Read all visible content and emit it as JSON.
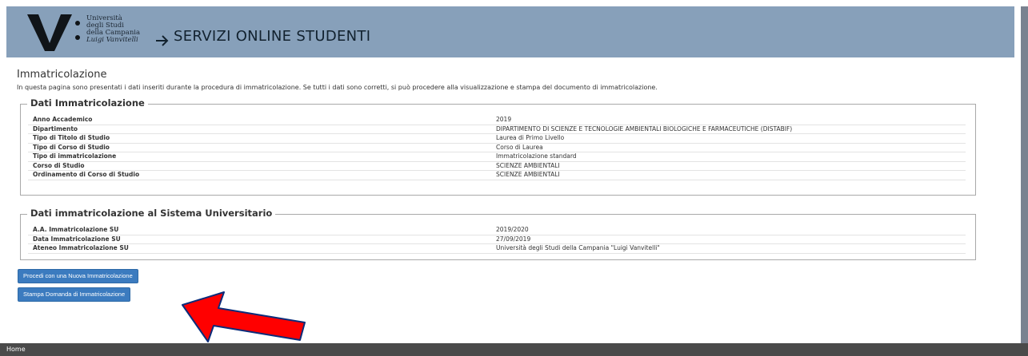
{
  "header": {
    "logo_lines": [
      "Università",
      "degli Studi",
      "della Campania",
      "Luigi Vanvitelli"
    ],
    "title": "SERVIZI ONLINE STUDENTI"
  },
  "page": {
    "title": "Immatricolazione",
    "intro": "In questa pagina sono presentati i dati inseriti durante la procedura di immatricolazione. Se tutti i dati sono corretti, si può procedere alla visualizzazione e stampa del documento di immatricolazione."
  },
  "section1": {
    "legend": "Dati Immatricolazione",
    "rows": [
      {
        "label": "Anno Accademico",
        "value": "2019"
      },
      {
        "label": "Dipartimento",
        "value": "DIPARTIMENTO DI SCIENZE E TECNOLOGIE AMBIENTALI BIOLOGICHE E FARMACEUTICHE (DISTABIF)"
      },
      {
        "label": "Tipo di Titolo di Studio",
        "value": "Laurea di Primo Livello"
      },
      {
        "label": "Tipo di Corso di Studio",
        "value": "Corso di Laurea"
      },
      {
        "label": "Tipo di immatricolazione",
        "value": "Immatricolazione standard"
      },
      {
        "label": "Corso di Studio",
        "value": "SCIENZE AMBIENTALI"
      },
      {
        "label": "Ordinamento di Corso di Studio",
        "value": "SCIENZE AMBIENTALI"
      }
    ]
  },
  "section2": {
    "legend": "Dati immatricolazione al Sistema Universitario",
    "rows": [
      {
        "label": "A.A. Immatricolazione SU",
        "value": "2019/2020"
      },
      {
        "label": "Data Immatricolazione SU",
        "value": "27/09/2019"
      },
      {
        "label": "Ateneo Immatricolazione SU",
        "value": "Università degli Studi della Campania \"Luigi Vanvitelli\""
      }
    ]
  },
  "buttons": {
    "new": "Procedi con una Nuova Immatricolazione",
    "print": "Stampa Domanda di Immatricolazione"
  },
  "footer": {
    "home": "Home"
  },
  "colors": {
    "header": "#87a0ba",
    "button": "#3b7bbf",
    "annotation_arrow": "#ff0000",
    "footer": "#4a4a4a"
  },
  "icons": {
    "header_arrow": "right-arrow-icon",
    "annotation": "red-pointer-arrow"
  }
}
